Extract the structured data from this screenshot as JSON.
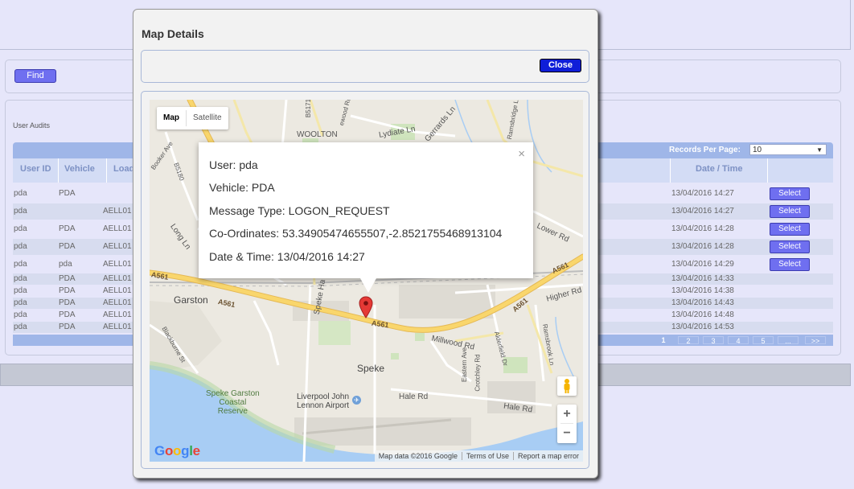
{
  "find_panel": {
    "find_label": "Find"
  },
  "audit": {
    "title": "User Audits",
    "records_per_page_label": "Records Per Page:",
    "records_per_page_value": "10",
    "columns": [
      "User ID",
      "Vehicle",
      "Load",
      "Date / Time"
    ],
    "rows": [
      {
        "user": "pda",
        "vehicle": "PDA",
        "load": "",
        "datetime": "13/04/2016 14:27",
        "select": "Select"
      },
      {
        "user": "pda",
        "vehicle": "",
        "load": "AELL01",
        "datetime": "13/04/2016 14:27",
        "select": "Select"
      },
      {
        "user": "pda",
        "vehicle": "PDA",
        "load": "AELL01",
        "datetime": "13/04/2016 14:28",
        "select": "Select"
      },
      {
        "user": "pda",
        "vehicle": "PDA",
        "load": "AELL01",
        "datetime": "13/04/2016 14:28",
        "select": "Select"
      },
      {
        "user": "pda",
        "vehicle": "pda",
        "load": "AELL01",
        "datetime": "13/04/2016 14:29",
        "select": "Select"
      },
      {
        "user": "pda",
        "vehicle": "PDA",
        "load": "AELL01",
        "datetime": "13/04/2016 14:33",
        "select": ""
      },
      {
        "user": "pda",
        "vehicle": "PDA",
        "load": "AELL01",
        "datetime": "13/04/2016 14:38",
        "select": ""
      },
      {
        "user": "pda",
        "vehicle": "PDA",
        "load": "AELL01",
        "datetime": "13/04/2016 14:43",
        "select": ""
      },
      {
        "user": "pda",
        "vehicle": "PDA",
        "load": "AELL01",
        "datetime": "13/04/2016 14:48",
        "select": ""
      },
      {
        "user": "pda",
        "vehicle": "PDA",
        "load": "AELL01",
        "datetime": "13/04/2016 14:53",
        "select": ""
      }
    ],
    "pager": [
      "1",
      "2",
      "3",
      "4",
      "5",
      "...",
      ">>"
    ]
  },
  "modal": {
    "title": "Map Details",
    "close_label": "Close",
    "map_type": {
      "map": "Map",
      "satellite": "Satellite"
    },
    "info": {
      "user": "User: pda",
      "vehicle": "Vehicle: PDA",
      "message_type": "Message Type: LOGON_REQUEST",
      "coordinates": "Co-Ordinates: 53.34905474655507,-2.8521755468913104",
      "datetime": "Date & Time: 13/04/2016 14:27",
      "close_glyph": "×"
    },
    "zoom_in": "+",
    "zoom_out": "−",
    "logo": "Google",
    "attribution": {
      "data": "Map data ©2016 Google",
      "terms": "Terms of Use",
      "report": "Report a map error"
    },
    "labels": {
      "woolton": "WOOLTON",
      "garston": "Garston",
      "speke": "Speke",
      "coastal": "Speke Garston\nCoastal\nReserve",
      "airport": "Liverpool John\nLennon Airport",
      "a561_1": "A561",
      "a561_2": "A561",
      "a561_3": "A561",
      "a561_4": "A561",
      "a561_5": "A561",
      "higher_rd": "Higher Rd",
      "lower_rd": "Lower Rd",
      "hale_rd_1": "Hale Rd",
      "hale_rd_2": "Hale Rd",
      "millwood_rd": "Millwood Rd",
      "lydiate_ln": "Lydiate Ln",
      "gerrards_ln": "Gerrards Ln",
      "long_ln": "Long Ln",
      "speke_hall": "Speke Ha",
      "eastern_ave": "Eastern Ave",
      "crotchley_rd": "Crotchley Rd",
      "alderfield": "Alderfield Dr",
      "ramsbrook_ln": "Ramsbrook Ln",
      "blackburne_st": "Blackburne St",
      "booker_ave": "Booker Ave",
      "b5180": "B5180",
      "b5171": "B5171",
      "elwood_rd": "ewood Rd",
      "ramsbridge_ln": "Ramsbridge Ln"
    }
  },
  "colors": {
    "accent_button": "#6f6ff0",
    "close_button": "#0f1ed8",
    "marker": "#e53935",
    "major_road": "#f9d66c"
  }
}
